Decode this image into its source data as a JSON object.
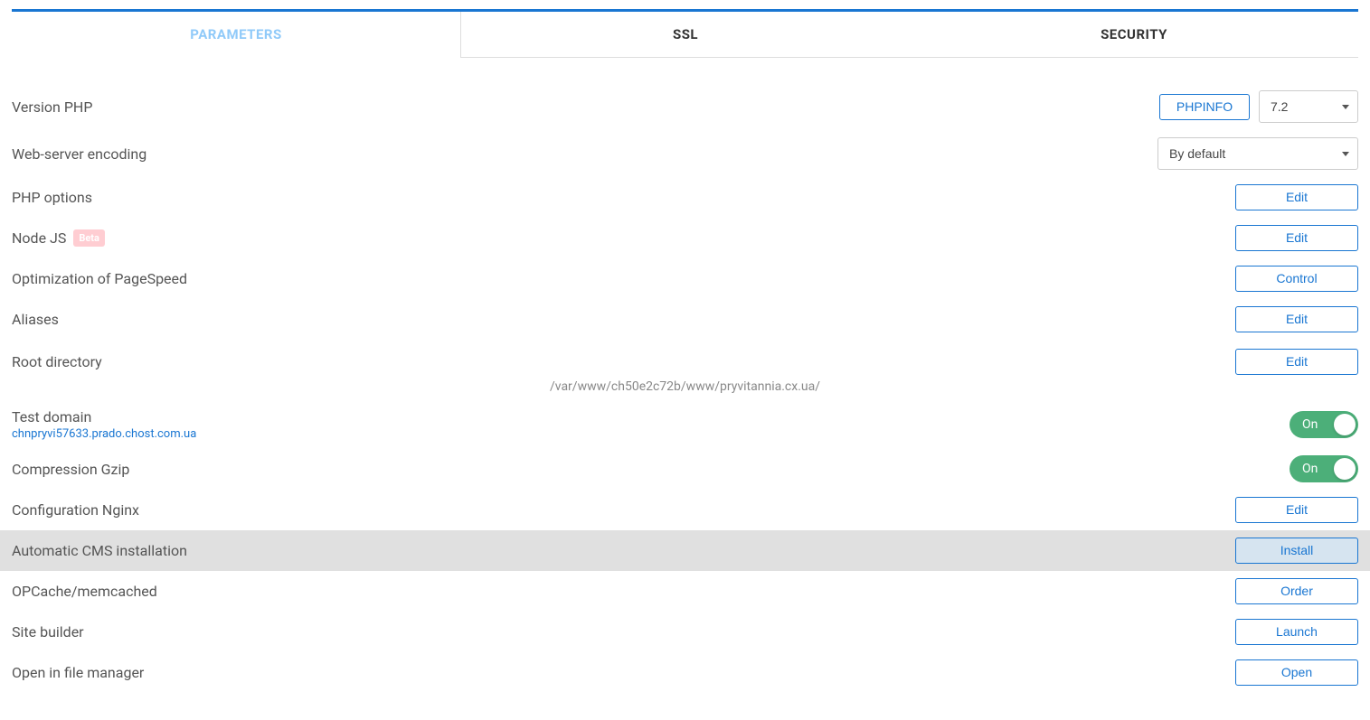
{
  "tabs": {
    "parameters": "PARAMETERS",
    "ssl": "SSL",
    "security": "SECURITY",
    "active": "parameters"
  },
  "rows": {
    "version_php": {
      "label": "Version PHP",
      "phpinfo_btn": "PHPINFO",
      "selected": "7.2"
    },
    "web_server_encoding": {
      "label": "Web-server encoding",
      "selected": "By default"
    },
    "php_options": {
      "label": "PHP options",
      "btn": "Edit"
    },
    "node_js": {
      "label": "Node JS",
      "badge": "Beta",
      "btn": "Edit"
    },
    "pagespeed": {
      "label": "Optimization of PageSpeed",
      "btn": "Control"
    },
    "aliases": {
      "label": "Aliases",
      "btn": "Edit"
    },
    "root_dir": {
      "label": "Root directory",
      "btn": "Edit",
      "path": "/var/www/ch50e2c72b/www/pryvitannia.cx.ua/"
    },
    "test_domain": {
      "label": "Test domain",
      "link": "chnpryvi57633.prado.chost.com.ua",
      "toggle": "On"
    },
    "gzip": {
      "label": "Compression Gzip",
      "toggle": "On"
    },
    "nginx": {
      "label": "Configuration Nginx",
      "btn": "Edit"
    },
    "cms": {
      "label": "Automatic CMS installation",
      "btn": "Install"
    },
    "opcache": {
      "label": "OPCache/memcached",
      "btn": "Order"
    },
    "site_builder": {
      "label": "Site builder",
      "btn": "Launch"
    },
    "file_manager": {
      "label": "Open in file manager",
      "btn": "Open"
    }
  }
}
